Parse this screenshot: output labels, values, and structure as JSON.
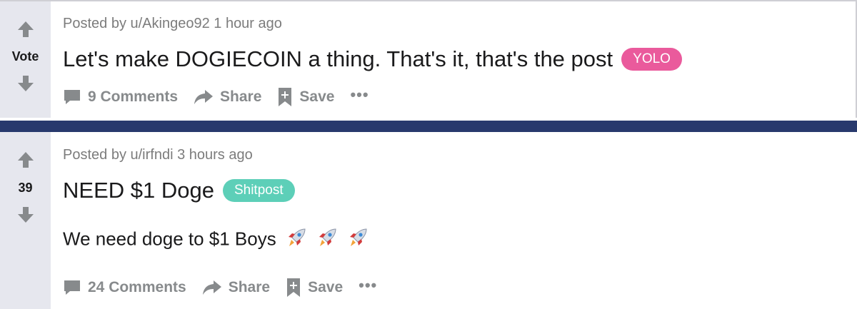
{
  "posts": [
    {
      "score": "Vote",
      "meta": "Posted by u/Akingeo92 1 hour ago",
      "title": "Let's make DOGIECOIN a thing. That's it, that's the post",
      "flair": "YOLO",
      "flair_color": "#ea5a9c",
      "actions": {
        "comments": "9 Comments",
        "share": "Share",
        "save": "Save",
        "more": "•••"
      }
    },
    {
      "score": "39",
      "meta": "Posted by u/irfndi 3 hours ago",
      "title": "NEED $1 Doge",
      "flair": "Shitpost",
      "flair_color": "#5dcfb8",
      "body": "We need doge to $1 Boys",
      "body_icons": [
        "rocket-icon",
        "rocket-icon",
        "rocket-icon"
      ],
      "actions": {
        "comments": "24 Comments",
        "share": "Share",
        "save": "Save",
        "more": "•••"
      }
    }
  ],
  "colors": {
    "vote_column": "#e6e7ee",
    "divider": "#28396d",
    "muted_text": "#878a8c"
  }
}
